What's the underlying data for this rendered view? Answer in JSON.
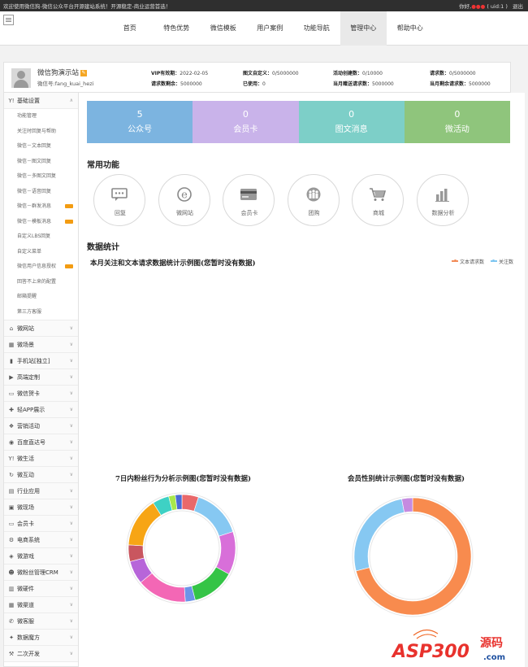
{
  "topbar": {
    "welcome": "欢迎使用微信狗-微信公众平台开源建站系统！开源稳定-商业运营首选！",
    "hello": "你好,",
    "uid": "( uid:1 )",
    "logout": "退出"
  },
  "nav": [
    "首页",
    "特色优势",
    "微信模板",
    "用户案例",
    "功能导航",
    "管理中心",
    "帮助中心"
  ],
  "nav_active": "管理中心",
  "profile": {
    "name": "微信狗演示站",
    "wechat_id": "微信号:fang_kuai_hezi",
    "stats": [
      [
        "VIP有效期：",
        "2022-02-05"
      ],
      [
        "请求数剩余：",
        "5000000"
      ],
      [
        "图文自定义：",
        "0/5000000"
      ],
      [
        "已使用：",
        "0"
      ],
      [
        "活动创建数：",
        "0/10000"
      ],
      [
        "当月赠送请求数：",
        "5000000"
      ],
      [
        "请求数：",
        "0/5000000"
      ],
      [
        "当月剩余请求数：",
        "5000000"
      ]
    ]
  },
  "sidebar": {
    "open_section": {
      "label": "基础设置",
      "icon": "Y!",
      "items": [
        "功能管理",
        "关注时回复与帮助",
        "微信－文本回复",
        "微信－图文回复",
        "微信－多图文回复",
        "微信－语音回复",
        "微信－群发消息",
        "微信－模板消息",
        "自定义LBS回复",
        "自定义菜单",
        "微信用户信息授权",
        "回答不上来的配置",
        "邮箱提醒",
        "第三方客服"
      ],
      "new_badges": [
        6,
        7,
        10
      ]
    },
    "sections": [
      {
        "icon": "home",
        "label": "微网站"
      },
      {
        "icon": "grid",
        "label": "微场景"
      },
      {
        "icon": "tablet",
        "label": "手机站[独立]"
      },
      {
        "icon": "video",
        "label": "高端定制"
      },
      {
        "icon": "card",
        "label": "微信贺卡"
      },
      {
        "icon": "app",
        "label": "轻APP展示"
      },
      {
        "icon": "gift",
        "label": "营销活动"
      },
      {
        "icon": "globe",
        "label": "百度直达号"
      },
      {
        "icon": "Y!",
        "label": "微生活"
      },
      {
        "icon": "refresh",
        "label": "微互动"
      },
      {
        "icon": "folder",
        "label": "行业应用"
      },
      {
        "icon": "screen",
        "label": "微现场"
      },
      {
        "icon": "card",
        "label": "会员卡"
      },
      {
        "icon": "gear",
        "label": "电商系统"
      },
      {
        "icon": "game",
        "label": "微游戏"
      },
      {
        "icon": "users",
        "label": "微粉丝管理CRM"
      },
      {
        "icon": "hardware",
        "label": "微硬件"
      },
      {
        "icon": "channel",
        "label": "微渠道"
      },
      {
        "icon": "service",
        "label": "微客服"
      },
      {
        "icon": "magic",
        "label": "数据魔方"
      },
      {
        "icon": "wrench",
        "label": "二次开发"
      }
    ]
  },
  "tiles": [
    {
      "num": "5",
      "label": "公众号",
      "color": "#7cb4e0"
    },
    {
      "num": "0",
      "label": "会员卡",
      "color": "#c9b3ea"
    },
    {
      "num": "0",
      "label": "图文消息",
      "color": "#7dcfc8"
    },
    {
      "num": "0",
      "label": "微活动",
      "color": "#8fc57c"
    }
  ],
  "common_title": "常用功能",
  "functions": [
    {
      "label": "回复",
      "icon": "chat-icon"
    },
    {
      "label": "微网站",
      "icon": "e-icon"
    },
    {
      "label": "会员卡",
      "icon": "card-icon"
    },
    {
      "label": "团购",
      "icon": "group-icon"
    },
    {
      "label": "商城",
      "icon": "cart-icon"
    },
    {
      "label": "数据分析",
      "icon": "bar-chart-icon"
    }
  ],
  "stats_title": "数据统计",
  "line_chart": {
    "title": "本月关注和文本请求数据统计示例图(您暂时没有数据)",
    "legend": [
      {
        "name": "文本请求数",
        "color": "#f28d5a"
      },
      {
        "name": "关注数",
        "color": "#7fc6f0"
      }
    ]
  },
  "donut1_title": "7日内粉丝行为分析示例图(您暂时没有数据)",
  "donut2_title": "会员性别统计示例图(您暂时没有数据)",
  "chart_data": [
    {
      "type": "pie",
      "title": "7日内粉丝行为分析示例图(您暂时没有数据)",
      "segments": [
        {
          "value": 5,
          "color": "#e9686a"
        },
        {
          "value": 15,
          "color": "#86c8f2"
        },
        {
          "value": 13,
          "color": "#d86fd9"
        },
        {
          "value": 13,
          "color": "#34c446"
        },
        {
          "value": 3,
          "color": "#6d94e8"
        },
        {
          "value": 15,
          "color": "#f367b5"
        },
        {
          "value": 7,
          "color": "#b765d9"
        },
        {
          "value": 5,
          "color": "#c9565f"
        },
        {
          "value": 15,
          "color": "#f7a515"
        },
        {
          "value": 5,
          "color": "#3ed1c4"
        },
        {
          "value": 2,
          "color": "#a8e84a"
        },
        {
          "value": 2,
          "color": "#4a6cd4"
        }
      ]
    },
    {
      "type": "pie",
      "title": "会员性别统计示例图(您暂时没有数据)",
      "segments": [
        {
          "value": 71,
          "color": "#f88b4e"
        },
        {
          "value": 26,
          "color": "#86c8f2"
        },
        {
          "value": 3,
          "color": "#c58be0"
        }
      ]
    }
  ],
  "watermark": {
    "text": "ASP300",
    "cn": "源码",
    "domain": ".com"
  }
}
